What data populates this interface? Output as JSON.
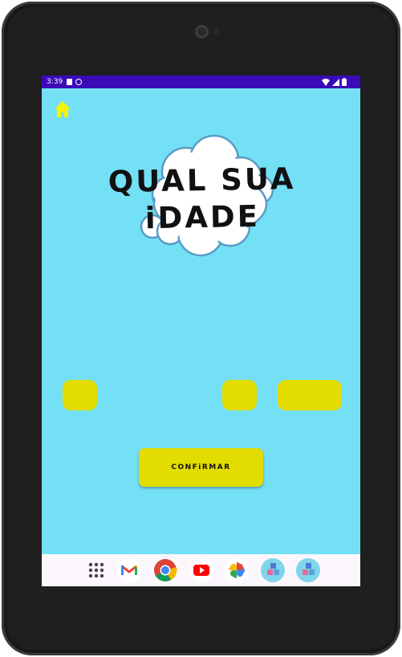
{
  "status_bar": {
    "time": "3:39"
  },
  "header": {
    "home_icon": "home-icon"
  },
  "main": {
    "title": "QUAL SUA\niDADE",
    "confirm_label": "CONFiRMAR"
  },
  "colors": {
    "background": "#74e0f6",
    "accent": "#e3dc00",
    "status_bar": "#3c0bb8",
    "home_icon": "#f4f400"
  },
  "dock": {
    "apps": [
      "apps-grid-icon",
      "gmail-icon",
      "chrome-icon",
      "youtube-icon",
      "photos-icon",
      "abc-blocks-app-icon",
      "abc-blocks-app-icon-2"
    ]
  }
}
